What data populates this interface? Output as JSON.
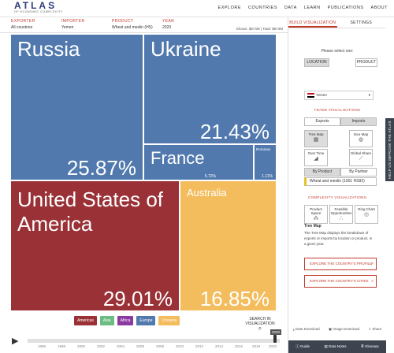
{
  "logo": {
    "main": "ATLAS",
    "sub": "OF ECONOMIC COMPLEXITY"
  },
  "nav": [
    "EXPLORE",
    "COUNTRIES",
    "DATA",
    "LEARN",
    "PUBLICATIONS",
    "ABOUT"
  ],
  "filters": {
    "exporter_label": "EXPORTER",
    "exporter": "All countries",
    "importer_label": "IMPORTER",
    "importer": "Yemen",
    "product_label": "PRODUCT",
    "product": "Wheat and meslin (HS)",
    "year_label": "YEAR",
    "year": "2020",
    "shown": "Shown: $674M | Total: $674M"
  },
  "treemap": [
    {
      "name": "Russia",
      "pct": "25.87%",
      "color": "#5179ae"
    },
    {
      "name": "Ukraine",
      "pct": "21.43%",
      "color": "#5179ae"
    },
    {
      "name": "France",
      "pct": "5.72%",
      "color": "#5179ae"
    },
    {
      "name": "Romania",
      "pct": "1.11%",
      "color": "#5179ae"
    },
    {
      "name": "United States of America",
      "pct": "29.01%",
      "color": "#9a3137"
    },
    {
      "name": "Australia",
      "pct": "16.85%",
      "color": "#f3bc5d"
    }
  ],
  "legend": [
    {
      "label": "Americas",
      "color": "#9a3137"
    },
    {
      "label": "Asia",
      "color": "#6cbc84"
    },
    {
      "label": "Africa",
      "color": "#8b3aa0"
    },
    {
      "label": "Europe",
      "color": "#5179ae"
    },
    {
      "label": "Oceania",
      "color": "#f3bc5d"
    }
  ],
  "search_vis": "SEARCH IN VISUALIZATION",
  "timeline": {
    "years": [
      "1995",
      "1998",
      "2000",
      "2002",
      "2004",
      "2006",
      "2008",
      "2010",
      "2012",
      "2014",
      "2016",
      "2018",
      "2020"
    ],
    "current": "2020"
  },
  "panel": {
    "tab_build": "BUILD VISUALIZATION",
    "tab_settings": "SETTINGS",
    "please_select": "Please select one:",
    "location_btn": "LOCATION",
    "product_btn": "PRODUCT",
    "country": "Yemen",
    "trade_vis": "TRADE VISUALIZATIONS",
    "exports": "Exports",
    "imports": "Imports",
    "vis": [
      "Tree Map",
      "Geo Map",
      "Over Time",
      "Global Share"
    ],
    "by_product": "By Product",
    "by_partner": "By Partner",
    "product_dd": "Wheat and meslin (1001 HS92)",
    "complexity_vis": "COMPLEXITY VISUALIZATIONS",
    "cvis": [
      "Product Space",
      "Feasible Opportunities",
      "Ring Chart"
    ],
    "desc_title": "Tree Map",
    "desc": "The Tree Map displays the breakdown of exports or imports by location or product, in a given year.",
    "link1": "EXPLORE THE COUNTRY'S PROFILE",
    "link2": "EXPLORE THE COUNTRY'S CITIES",
    "footer": [
      "Data Download",
      "Image Download",
      "Share"
    ],
    "bottom": [
      "Guide",
      "Data Notes",
      "Glossary"
    ]
  },
  "side_tab": "HELP US IMPROVE THE ATLAS"
}
